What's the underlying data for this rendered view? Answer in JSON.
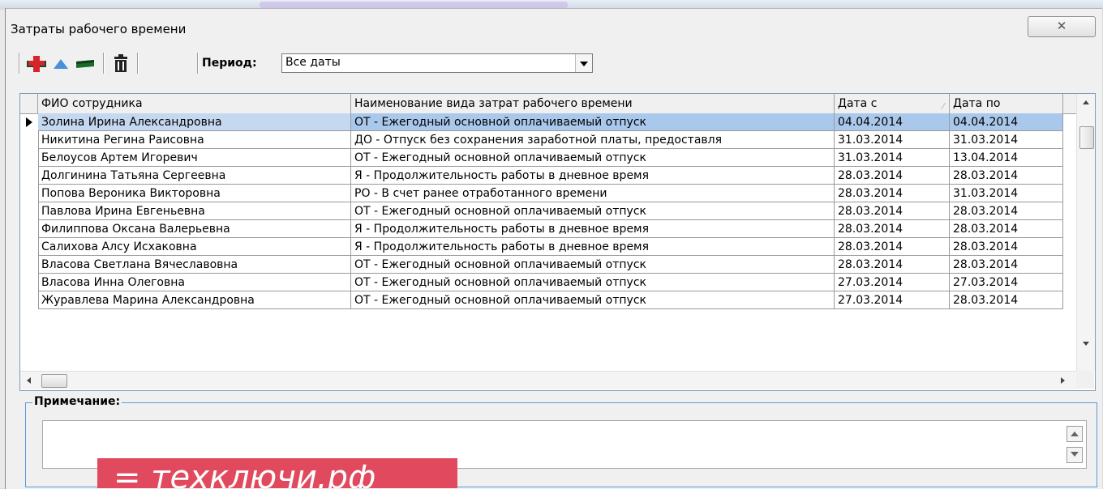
{
  "window": {
    "title": "Затраты рабочего времени",
    "close_label": "✕"
  },
  "toolbar": {
    "period_label": "Период:",
    "period_value": "Все даты",
    "colors": {
      "add": "#d8232a",
      "edit": "#4a90d9",
      "minus": "#1a6b2a"
    }
  },
  "grid": {
    "columns": [
      "ФИО сотрудника",
      "Наименование вида затрат рабочего времени",
      "Дата с",
      "Дата по"
    ],
    "rows": [
      [
        "Золина Ирина Александровна",
        "ОТ - Ежегодный основной оплачиваемый отпуск",
        "04.04.2014",
        "04.04.2014"
      ],
      [
        "Никитина Регина Раисовна",
        "ДО - Отпуск без сохранения заработной платы, предоставля",
        "31.03.2014",
        "31.03.2014"
      ],
      [
        "Белоусов Артем Игоревич",
        "ОТ - Ежегодный основной оплачиваемый отпуск",
        "31.03.2014",
        "13.04.2014"
      ],
      [
        "Долгинина Татьяна Сергеевна",
        "Я - Продолжительность работы в дневное время",
        "28.03.2014",
        "28.03.2014"
      ],
      [
        "Попова Вероника Викторовна",
        "РО - В счет ранее отработанного времени",
        "28.03.2014",
        "31.03.2014"
      ],
      [
        "Павлова Ирина Евгеньевна",
        "ОТ - Ежегодный основной оплачиваемый отпуск",
        "28.03.2014",
        "28.03.2014"
      ],
      [
        "Филиппова Оксана Валерьевна",
        "Я - Продолжительность работы в дневное время",
        "28.03.2014",
        "28.03.2014"
      ],
      [
        "Салихова Алсу Исхаковна",
        "Я - Продолжительность работы в дневное время",
        "28.03.2014",
        "28.03.2014"
      ],
      [
        "Власова Светлана Вячеславовна",
        "ОТ - Ежегодный основной оплачиваемый отпуск",
        "28.03.2014",
        "28.03.2014"
      ],
      [
        "Власова  Инна Олеговна",
        "ОТ - Ежегодный основной оплачиваемый отпуск",
        "27.03.2014",
        "27.03.2014"
      ],
      [
        "Журавлева Марина Александровна",
        "ОТ - Ежегодный основной оплачиваемый отпуск",
        "27.03.2014",
        "28.03.2014"
      ]
    ],
    "selected_row": 0,
    "selection_color": "#a9c8ec"
  },
  "note": {
    "label": "Примечание:",
    "value": ""
  },
  "watermark": {
    "text": "= техключи.рф"
  }
}
